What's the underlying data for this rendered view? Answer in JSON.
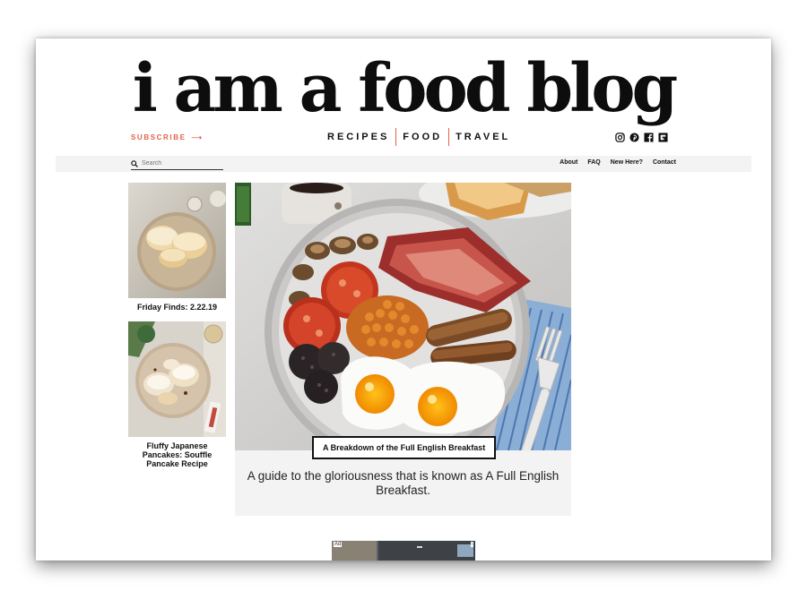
{
  "site": {
    "logo": "i am a food blog"
  },
  "header": {
    "subscribe_label": "SUBSCRIBE",
    "subscribe_arrow": "⟶",
    "nav": [
      "RECIPES",
      "FOOD",
      "TRAVEL"
    ],
    "social_icons": [
      "instagram-icon",
      "pinterest-icon",
      "facebook-icon",
      "flipboard-icon"
    ]
  },
  "utility_bar": {
    "search_placeholder": "Search",
    "links": [
      "About",
      "FAQ",
      "New Here?",
      "Contact"
    ]
  },
  "sidebar": {
    "cards": [
      {
        "title": "Friday Finds: 2.22.19"
      },
      {
        "title": "Fluffy Japanese Pancakes: Souffle Pancake Recipe"
      }
    ]
  },
  "feature": {
    "tag": "A Breakdown of the Full English Breakfast",
    "description": "A guide to the gloriousness that is known as A Full English Breakfast."
  },
  "ad": {
    "label": "Ad",
    "info": "i"
  },
  "colors": {
    "accent": "#e0624a",
    "bar": "#f3f3f3",
    "text": "#111111"
  }
}
